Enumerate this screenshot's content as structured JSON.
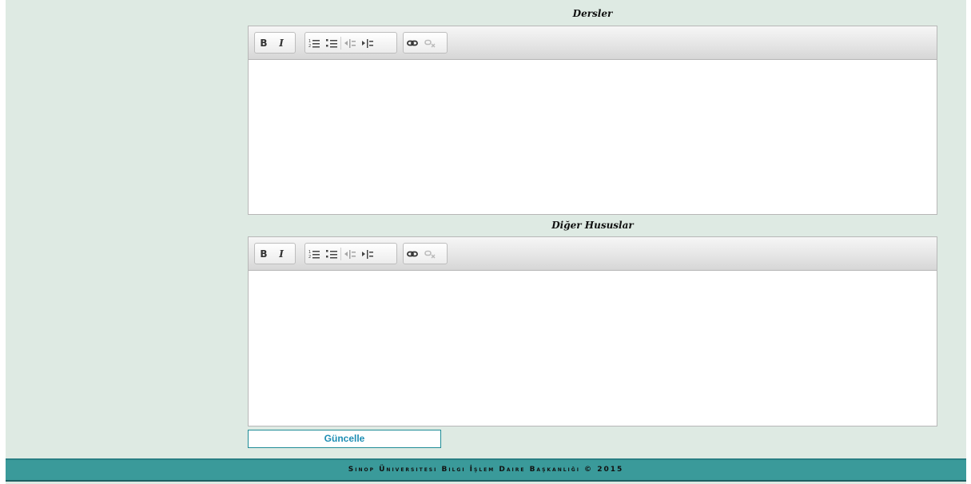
{
  "sections": [
    {
      "title": "Dersler",
      "toolbar": {
        "bold": "B",
        "italic": "I"
      },
      "content": ""
    },
    {
      "title": "Diğer Hususlar",
      "toolbar": {
        "bold": "B",
        "italic": "I"
      },
      "content": ""
    }
  ],
  "update_button": "Güncelle",
  "footer": "Sinop Üniversitesi Bilgi İşlem Daire Başkanlığı © 2015",
  "colors": {
    "page_bg": "#deeae3",
    "footer_bg": "#3a9a9a",
    "button_text": "#1d8eb4"
  }
}
